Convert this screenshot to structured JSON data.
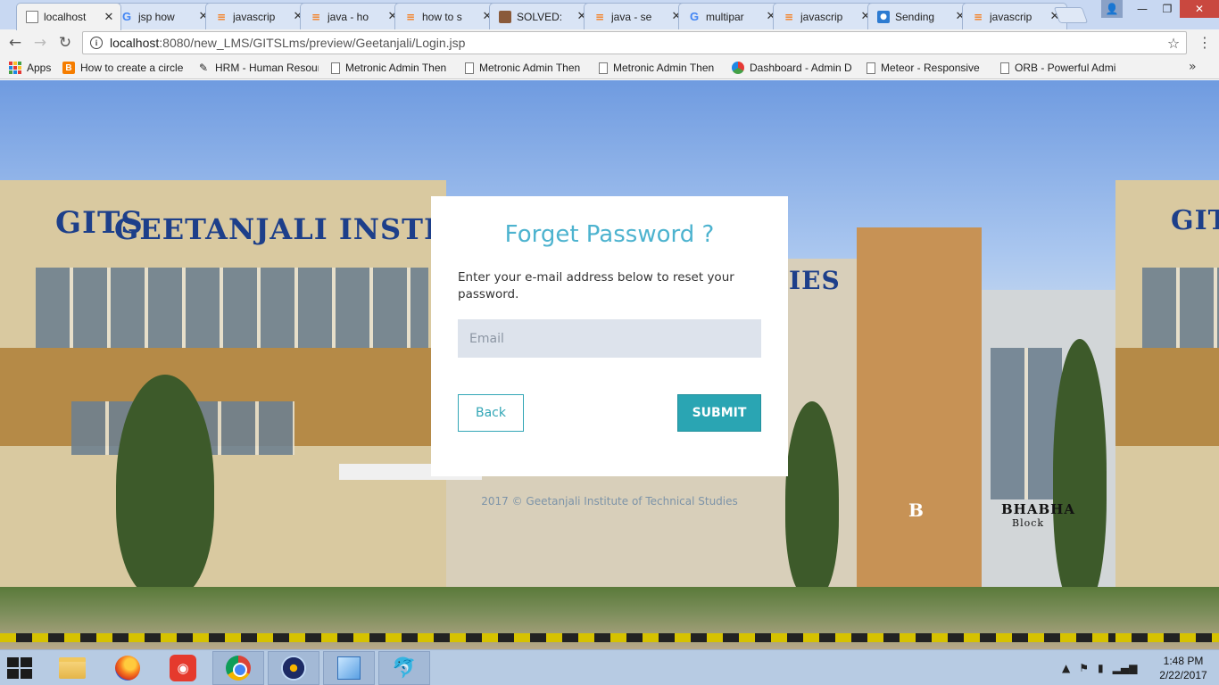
{
  "browser": {
    "tabs": [
      {
        "label": "localhost",
        "favicon": "document-icon",
        "active": true
      },
      {
        "label": "jsp how",
        "favicon": "google-icon"
      },
      {
        "label": "javascrip",
        "favicon": "stackoverflow-icon"
      },
      {
        "label": "java - ho",
        "favicon": "stackoverflow-icon"
      },
      {
        "label": "how to s",
        "favicon": "stackoverflow-icon"
      },
      {
        "label": "SOLVED:",
        "favicon": "photo-icon"
      },
      {
        "label": "java - se",
        "favicon": "stackoverflow-icon"
      },
      {
        "label": "multipar",
        "favicon": "google-icon"
      },
      {
        "label": "javascrip",
        "favicon": "stackoverflow-icon"
      },
      {
        "label": "Sending",
        "favicon": "blue-site-icon"
      },
      {
        "label": "javascrip",
        "favicon": "stackoverflow-icon"
      }
    ],
    "url_host": "localhost",
    "url_rest": ":8080/new_LMS/GITSLms/preview/Geetanjali/Login.jsp",
    "bookmarks": [
      {
        "label": "Apps",
        "icon": "apps-grid-icon"
      },
      {
        "label": "How to create a circle",
        "icon": "blogger-icon"
      },
      {
        "label": "HRM - Human Resour",
        "icon": "hrm-icon"
      },
      {
        "label": "Metronic Admin Then",
        "icon": "page-icon"
      },
      {
        "label": "Metronic Admin Then",
        "icon": "page-icon"
      },
      {
        "label": "Metronic Admin Then",
        "icon": "page-icon"
      },
      {
        "label": "Dashboard - Admin D",
        "icon": "dashboard-icon"
      },
      {
        "label": "Meteor - Responsive",
        "icon": "page-icon"
      },
      {
        "label": "ORB - Powerful Admi",
        "icon": "page-icon"
      }
    ]
  },
  "page": {
    "background_signs": {
      "main_sign": "GEETANJALI INSTIT",
      "right_sign": "IES",
      "logo": "GITS",
      "block_sign": "BHABHA",
      "block_sub": "Block",
      "b_letter": "B"
    },
    "card": {
      "title": "Forget Password ?",
      "description": "Enter your e-mail address below to reset your password.",
      "email_placeholder": "Email",
      "email_value": "",
      "back_label": "Back",
      "submit_label": "SUBMIT"
    },
    "copyright": "2017 © Geetanjali Institute of Technical Studies",
    "colors": {
      "accent": "#4db3cf",
      "button": "#2aa5b3",
      "input_bg": "#dde3ec"
    }
  },
  "taskbar": {
    "apps": [
      "file-explorer-icon",
      "firefox-icon",
      "red-app-icon",
      "chrome-icon",
      "media-disc-icon",
      "cube-app-icon",
      "dolphin-icon"
    ],
    "time": "1:48 PM",
    "date": "2/22/2017"
  }
}
